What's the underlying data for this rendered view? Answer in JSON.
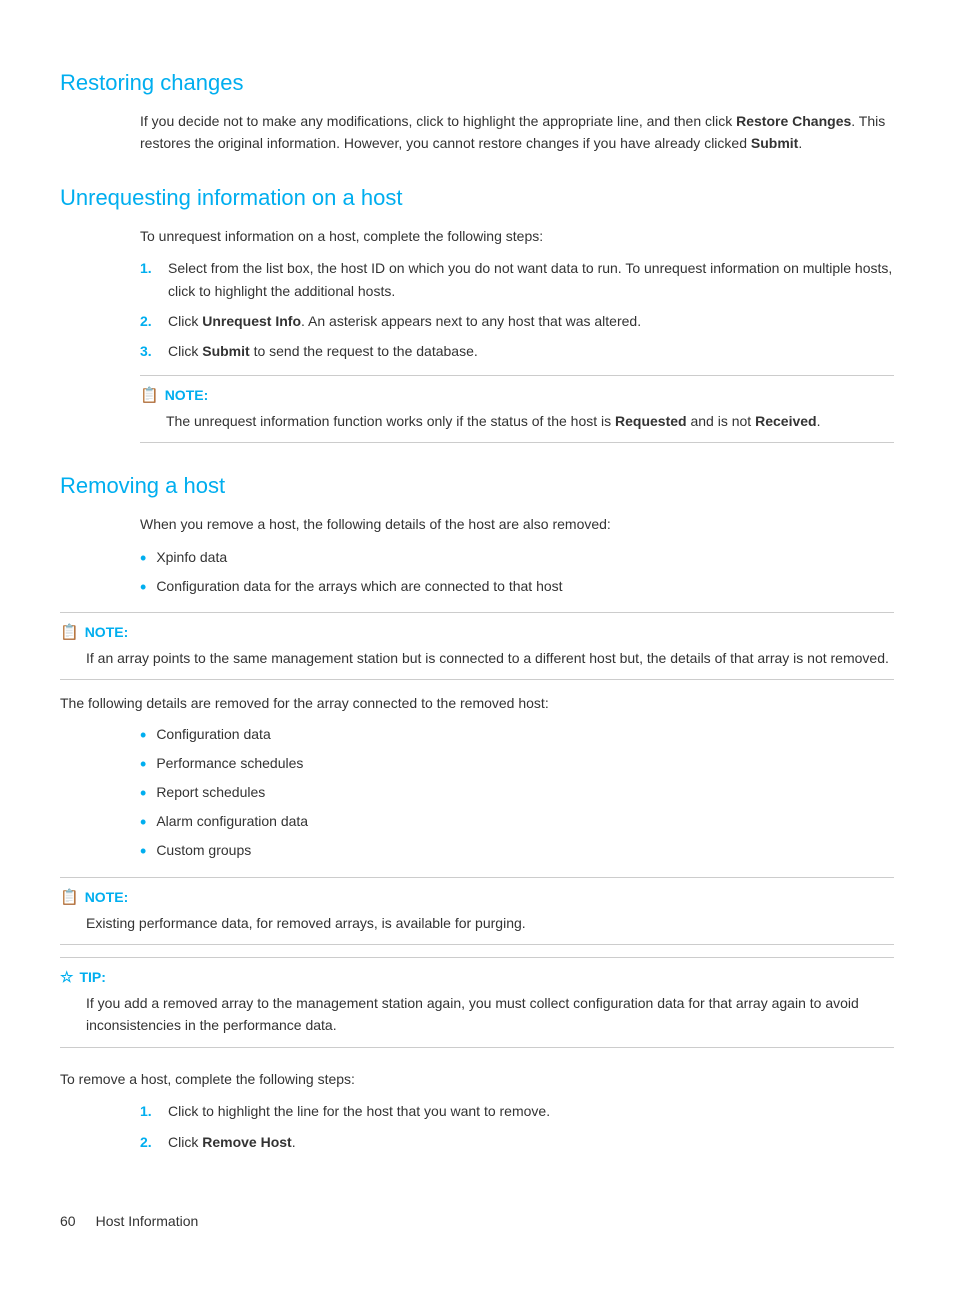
{
  "sections": {
    "restoring_changes": {
      "title": "Restoring changes",
      "body": "If you decide not to make any modifications, click to highlight the appropriate line, and then click ",
      "bold1": "Restore Changes",
      "body2": ". This restores the original information. However, you cannot restore changes if you have already clicked ",
      "bold2": "Submit",
      "body3": "."
    },
    "unrequesting": {
      "title": "Unrequesting information on a host",
      "intro": "To unrequest information on a host, complete the following steps:",
      "steps": [
        {
          "number": "1.",
          "text_before": "Select from the list box, the host ID on which you do not want data to run. To unrequest information on multiple hosts, click to highlight the additional hosts."
        },
        {
          "number": "2.",
          "text_before": "Click ",
          "bold": "Unrequest Info",
          "text_after": ". An asterisk appears next to any host that was altered."
        },
        {
          "number": "3.",
          "text_before": "Click ",
          "bold": "Submit",
          "text_after": " to send the request to the database."
        }
      ],
      "note": {
        "label": "NOTE:",
        "content_before": "The unrequest information function works only if the status of the host is ",
        "bold1": "Requested",
        "content_middle": " and is not ",
        "bold2": "Received",
        "content_after": "."
      }
    },
    "removing_host": {
      "title": "Removing a host",
      "intro": "When you remove a host, the following details of the host are also removed:",
      "bullets1": [
        "Xpinfo data",
        "Configuration data for the arrays which are connected to that host"
      ],
      "note1": {
        "label": "NOTE:",
        "content": "If an array points to the same management station but is connected to a different host but, the details of that array is not removed."
      },
      "details_intro": "The following details are removed for the array connected to the removed host:",
      "bullets2": [
        "Configuration data",
        "Performance schedules",
        "Report schedules",
        "Alarm configuration data",
        "Custom groups"
      ],
      "note2": {
        "label": "NOTE:",
        "content": "Existing performance data, for removed arrays, is available for purging."
      },
      "tip": {
        "label": "TIP:",
        "content": "If you add a removed array to the management station again, you must collect configuration data for that array again to avoid inconsistencies in the performance data."
      },
      "steps_intro": "To remove a host, complete the following steps:",
      "steps": [
        {
          "number": "1.",
          "text": "Click to highlight the line for the host that you want to remove."
        },
        {
          "number": "2.",
          "text_before": "Click ",
          "bold": "Remove Host",
          "text_after": "."
        }
      ]
    }
  },
  "footer": {
    "page_number": "60",
    "section": "Host Information"
  }
}
